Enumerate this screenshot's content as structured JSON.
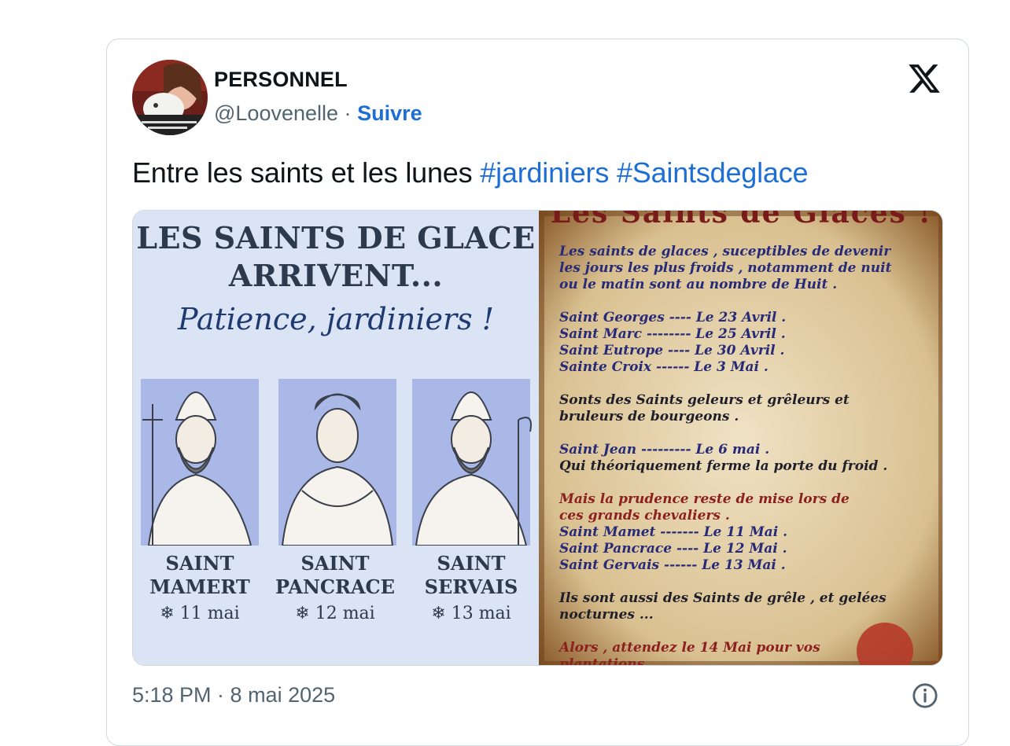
{
  "user": {
    "display_name": "PERSONNEL",
    "handle": "@Loovenelle",
    "separator": "·",
    "follow_label": "Suivre"
  },
  "tweet": {
    "text": "Entre les saints et les lunes",
    "hashtags": [
      "#jardiniers",
      "#Saintsdeglace"
    ]
  },
  "media": {
    "left": {
      "title_line1": "LES SAINTS DE GLACE",
      "title_line2": "ARRIVENT...",
      "subtitle": "Patience, jardiniers !",
      "saints": [
        {
          "line1": "SAINT",
          "line2": "MAMERT",
          "date": "❄ 11 mai"
        },
        {
          "line1": "SAINT",
          "line2": "PANCRACE",
          "date": "❄ 12 mai"
        },
        {
          "line1": "SAINT",
          "line2": "SERVAIS",
          "date": "❄ 13 mai"
        }
      ]
    },
    "right": {
      "title": "Les Saints de Glaces !",
      "lines": [
        {
          "text": "Les saints de glaces , suceptibles de devenir",
          "color": "blue"
        },
        {
          "text": "les jours les plus froids , notamment de nuit",
          "color": "blue"
        },
        {
          "text": "ou le matin sont au nombre de Huit .",
          "color": "blue"
        },
        {
          "text": "Saint Georges ---- Le 23 Avril .",
          "color": "blue"
        },
        {
          "text": "Saint Marc -------- Le 25 Avril .",
          "color": "blue"
        },
        {
          "text": "Saint Eutrope ---- Le 30 Avril .",
          "color": "blue"
        },
        {
          "text": "Sainte Croix ------ Le 3 Mai .",
          "color": "blue"
        },
        {
          "text": "Sonts des Saints geleurs et grêleurs et",
          "color": "dark"
        },
        {
          "text": "bruleurs de bourgeons .",
          "color": "dark"
        },
        {
          "text": "Saint Jean --------- Le 6 mai .",
          "color": "blue"
        },
        {
          "text": "Qui théoriquement ferme la porte du froid .",
          "color": "dark"
        },
        {
          "text": "Mais la prudence reste de mise lors de",
          "color": "red"
        },
        {
          "text": "ces grands chevaliers .",
          "color": "red"
        },
        {
          "text": "Saint Mamet ------- Le 11 Mai .",
          "color": "blue"
        },
        {
          "text": "Saint Pancrace ---- Le 12 Mai .",
          "color": "blue"
        },
        {
          "text": "Saint Gervais ------ Le 13 Mai .",
          "color": "blue"
        },
        {
          "text": "Ils sont aussi des Saints de grêle , et gelées",
          "color": "dark"
        },
        {
          "text": "nocturnes ...",
          "color": "dark"
        },
        {
          "text": "Alors , attendez le 14 Mai pour vos",
          "color": "red"
        },
        {
          "text": "plantations .",
          "color": "red"
        }
      ]
    }
  },
  "footer": {
    "timestamp": "5:18 PM · 8 mai 2025"
  },
  "colors": {
    "link": "#1d6fd6",
    "muted": "#536471",
    "text": "#0f1419",
    "border": "#cfd9de"
  },
  "icons": [
    "x-logo-icon",
    "info-icon"
  ]
}
